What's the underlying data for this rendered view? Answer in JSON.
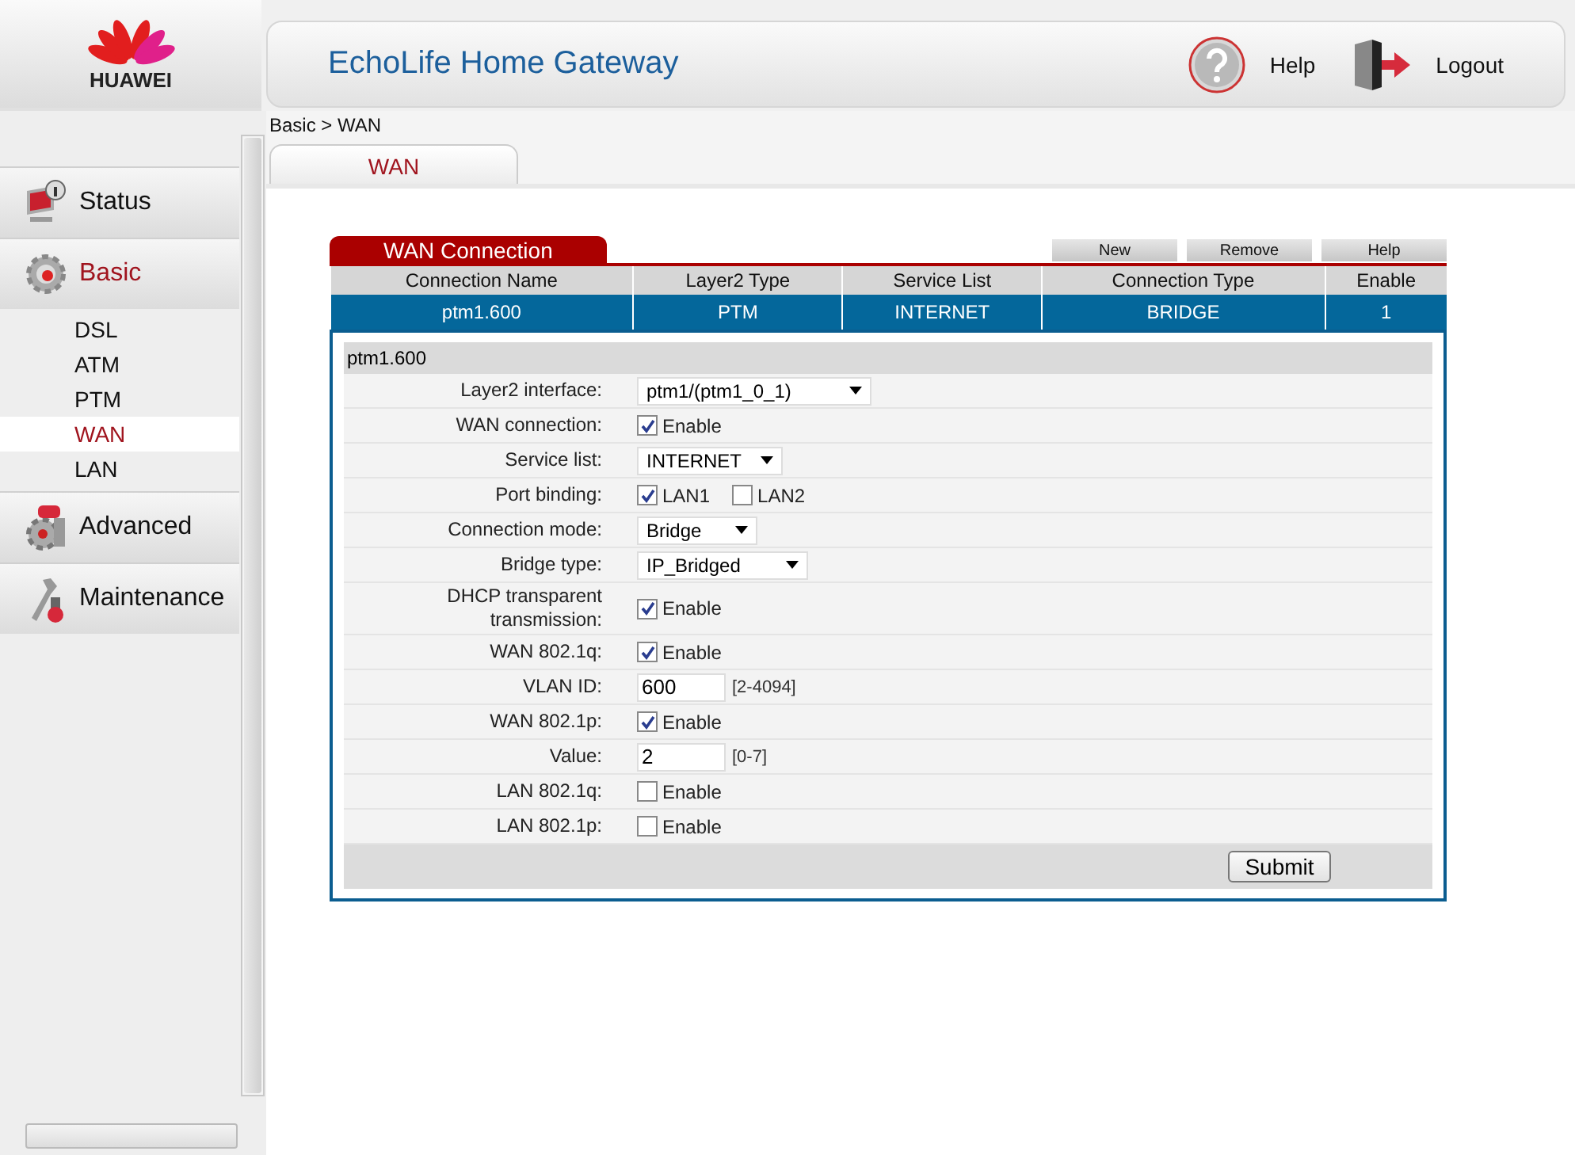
{
  "logo": {
    "text": "HUAWEI"
  },
  "header": {
    "title": "EchoLife Home Gateway",
    "help": "Help",
    "logout": "Logout"
  },
  "breadcrumb": "Basic > WAN",
  "nav": [
    {
      "label": "Status",
      "selected": false
    },
    {
      "label": "Basic",
      "selected": true,
      "children": [
        {
          "label": "DSL",
          "selected": false
        },
        {
          "label": "ATM",
          "selected": false
        },
        {
          "label": "PTM",
          "selected": false
        },
        {
          "label": "WAN",
          "selected": true
        },
        {
          "label": "LAN",
          "selected": false
        }
      ]
    },
    {
      "label": "Advanced",
      "selected": false
    },
    {
      "label": "Maintenance",
      "selected": false
    }
  ],
  "tabs": [
    {
      "label": "WAN",
      "selected": true
    }
  ],
  "connections": {
    "title": "WAN Connection",
    "buttons": [
      "New",
      "Remove",
      "Help"
    ],
    "columns": [
      "Connection Name",
      "Layer2 Type",
      "Service List",
      "Connection Type",
      "Enable"
    ],
    "rows": [
      {
        "cells": [
          "ptm1.600",
          "PTM",
          "INTERNET",
          "BRIDGE",
          "1"
        ],
        "selected": true
      }
    ]
  },
  "detail": {
    "title": "ptm1.600",
    "fields": [
      {
        "kind": "select",
        "label": "Layer2 interface:",
        "value": "ptm1/(ptm1_0_1)"
      },
      {
        "kind": "checkbox",
        "label": "WAN connection:",
        "options": [
          {
            "label": "Enable",
            "checked": true
          }
        ]
      },
      {
        "kind": "select",
        "label": "Service list:",
        "value": "INTERNET"
      },
      {
        "kind": "checkbox",
        "label": "Port binding:",
        "options": [
          {
            "label": "LAN1",
            "checked": true
          },
          {
            "label": "LAN2",
            "checked": false
          }
        ]
      },
      {
        "kind": "select",
        "label": "Connection mode:",
        "value": "Bridge"
      },
      {
        "kind": "select",
        "label": "Bridge type:",
        "value": "IP_Bridged"
      },
      {
        "kind": "checkbox",
        "label": "DHCP transparent transmission:",
        "options": [
          {
            "label": "Enable",
            "checked": true
          }
        ]
      },
      {
        "kind": "checkbox",
        "label": "WAN 802.1q:",
        "options": [
          {
            "label": "Enable",
            "checked": true
          }
        ]
      },
      {
        "kind": "input",
        "label": "VLAN ID:",
        "value": "600",
        "range": "[2-4094]"
      },
      {
        "kind": "checkbox",
        "label": "WAN 802.1p:",
        "options": [
          {
            "label": "Enable",
            "checked": true
          }
        ]
      },
      {
        "kind": "input",
        "label": "Value:",
        "value": "2",
        "range": "[0-7]"
      },
      {
        "kind": "checkbox",
        "label": "LAN 802.1q:",
        "options": [
          {
            "label": "Enable",
            "checked": false
          }
        ]
      },
      {
        "kind": "checkbox",
        "label": "LAN 802.1p:",
        "options": [
          {
            "label": "Enable",
            "checked": false
          }
        ]
      }
    ],
    "submit": "Submit"
  }
}
